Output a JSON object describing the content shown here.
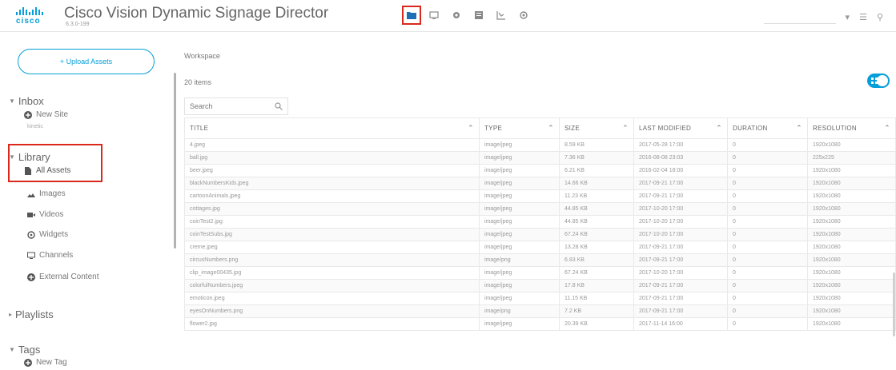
{
  "app": {
    "brand": "cisco",
    "title": "Cisco Vision Dynamic Signage Director",
    "version": "6.3.0-199"
  },
  "nav": {
    "icons": [
      "folder-icon",
      "monitor-icon",
      "gear-icon",
      "grid-icon",
      "chart-icon",
      "settings-icon"
    ],
    "active": "folder-icon"
  },
  "header_right": {
    "icons": [
      "chevron-down-icon",
      "menu-icon",
      "user-icon"
    ]
  },
  "sidebar": {
    "upload_label": "+ Upload Assets",
    "inbox": {
      "label": "Inbox",
      "new_site": "New Site",
      "sub": "kinetic"
    },
    "library": {
      "label": "Library",
      "all_assets": "All Assets",
      "items": [
        {
          "label": "Images",
          "icon": "images-icon"
        },
        {
          "label": "Videos",
          "icon": "video-icon"
        },
        {
          "label": "Widgets",
          "icon": "widget-icon"
        },
        {
          "label": "Channels",
          "icon": "channel-icon"
        },
        {
          "label": "External Content",
          "icon": "external-icon"
        }
      ]
    },
    "playlists": {
      "label": "Playlists"
    },
    "tags": {
      "label": "Tags",
      "new_tag": "New Tag"
    }
  },
  "main": {
    "breadcrumb": "Workspace",
    "count": "20 items",
    "search_placeholder": "Search",
    "columns": [
      "TITLE",
      "TYPE",
      "SIZE",
      "LAST MODIFIED",
      "DURATION",
      "RESOLUTION"
    ],
    "rows": [
      [
        "4.jpeg",
        "image/jpeg",
        "8.59 KB",
        "2017-05-28 17:00",
        "0",
        "1920x1080"
      ],
      [
        "ball.jpg",
        "image/jpeg",
        "7.36 KB",
        "2016-08-08 23:03",
        "0",
        "225x225"
      ],
      [
        "beer.jpeg",
        "image/jpeg",
        "6.21 KB",
        "2016-02-04 18:00",
        "0",
        "1920x1080"
      ],
      [
        "blackNumbersKids.jpeg",
        "image/jpeg",
        "14.66 KB",
        "2017-09-21 17:00",
        "0",
        "1920x1080"
      ],
      [
        "cartoonAnimals.jpeg",
        "image/jpeg",
        "11.23 KB",
        "2017-09-21 17:00",
        "0",
        "1920x1080"
      ],
      [
        "cottages.jpg",
        "image/jpeg",
        "44.85 KB",
        "2017-10-20 17:00",
        "0",
        "1920x1080"
      ],
      [
        "coinTest2.jpg",
        "image/jpeg",
        "44.85 KB",
        "2017-10-20 17:00",
        "0",
        "1920x1080"
      ],
      [
        "coinTestSubs.jpg",
        "image/jpeg",
        "67.24 KB",
        "2017-10-20 17:00",
        "0",
        "1920x1080"
      ],
      [
        "creme.jpeg",
        "image/jpeg",
        "13.28 KB",
        "2017-09-21 17:00",
        "0",
        "1920x1080"
      ],
      [
        "circusNumbers.png",
        "image/png",
        "6.83 KB",
        "2017-09-21 17:00",
        "0",
        "1920x1080"
      ],
      [
        "clip_image00435.jpg",
        "image/jpeg",
        "67.24 KB",
        "2017-10-20 17:00",
        "0",
        "1920x1080"
      ],
      [
        "colorfulNumbers.jpeg",
        "image/jpeg",
        "17.8 KB",
        "2017-09-21 17:00",
        "0",
        "1920x1080"
      ],
      [
        "emoticon.jpeg",
        "image/jpeg",
        "11.15 KB",
        "2017-09-21 17:00",
        "0",
        "1920x1080"
      ],
      [
        "eyesOnNumbers.png",
        "image/png",
        "7.2 KB",
        "2017-09-21 17:00",
        "0",
        "1920x1080"
      ],
      [
        "flower2.jpg",
        "image/jpeg",
        "20.39 KB",
        "2017-11-14 16:00",
        "0",
        "1920x1080"
      ]
    ]
  }
}
